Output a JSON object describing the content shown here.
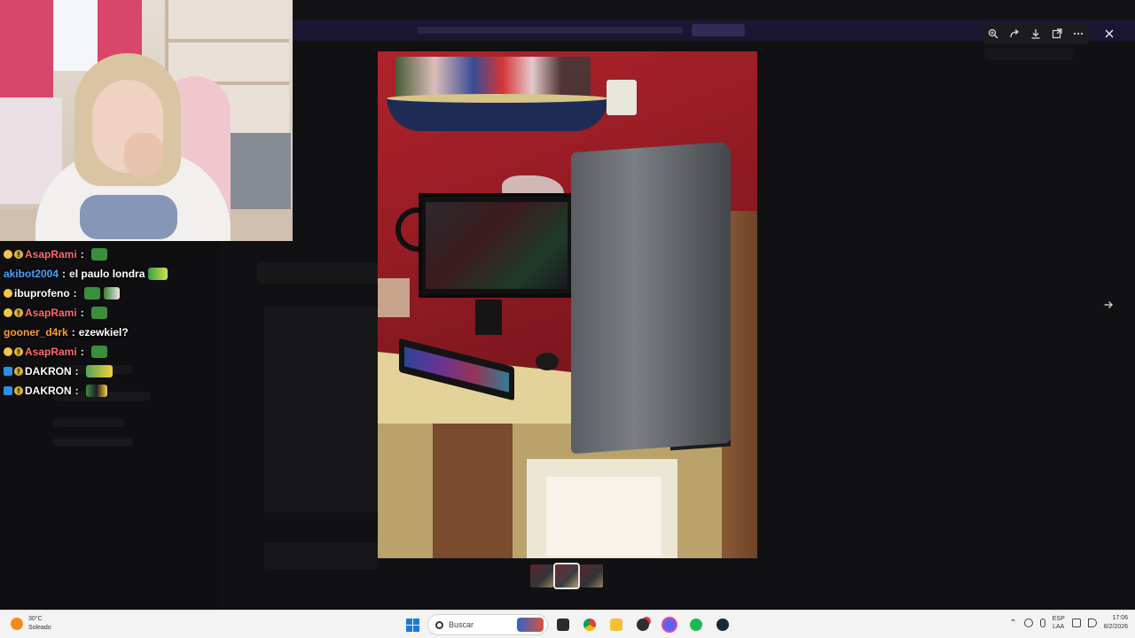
{
  "viewer": {
    "toolbar_icons": [
      "zoom-in-icon",
      "forward-icon",
      "download-icon",
      "open-in-browser-icon",
      "more-icon"
    ],
    "close_icon": "close-icon",
    "next_icon": "arrow-right-icon",
    "thumbnails": 3,
    "active_thumbnail": 1
  },
  "chat": {
    "messages": [
      {
        "badges": [
          "gear",
          "bits"
        ],
        "user": "AsapRami",
        "user_color": "#ff6b6b",
        "text": "",
        "emotes": [
          "frog"
        ]
      },
      {
        "badges": [],
        "user": "akibot2004",
        "user_color": "#4aa3ff",
        "text": "el paulo londra",
        "emotes": [
          "pepe"
        ]
      },
      {
        "badges": [
          "gear"
        ],
        "user": "ibuprofeno",
        "user_color": "#ffffff",
        "text": "",
        "emotes": [
          "frog",
          "cap"
        ]
      },
      {
        "badges": [
          "gear",
          "bits"
        ],
        "user": "AsapRami",
        "user_color": "#ff6b6b",
        "text": "",
        "emotes": [
          "frog"
        ]
      },
      {
        "badges": [],
        "user": "gooner_d4rk",
        "user_color": "#ff9f2e",
        "text": "ezewkiel?",
        "emotes": []
      },
      {
        "badges": [
          "gear",
          "bits"
        ],
        "user": "AsapRami",
        "user_color": "#ff6b6b",
        "text": "",
        "emotes": [
          "frog"
        ]
      },
      {
        "badges": [
          "sub",
          "bits"
        ],
        "user": "DAKRON",
        "user_color": "#ffffff",
        "text": "",
        "emotes": [
          "happy"
        ]
      },
      {
        "badges": [
          "sub",
          "bits"
        ],
        "user": "DAKRON",
        "user_color": "#ffffff",
        "text": "",
        "emotes": [
          "glasses"
        ]
      }
    ],
    "separator": ":"
  },
  "taskbar": {
    "weather_temp": "30°C",
    "weather_desc": "Soleado",
    "search_placeholder": "Buscar",
    "apps": [
      "file-explorer-dark-icon",
      "chrome-icon",
      "folder-icon",
      "discord-alt-icon",
      "discord-icon",
      "spotify-icon",
      "steam-icon"
    ],
    "lang_top": "ESP",
    "lang_bottom": "LAA",
    "time": "17:06",
    "date": "8/2/2026"
  }
}
